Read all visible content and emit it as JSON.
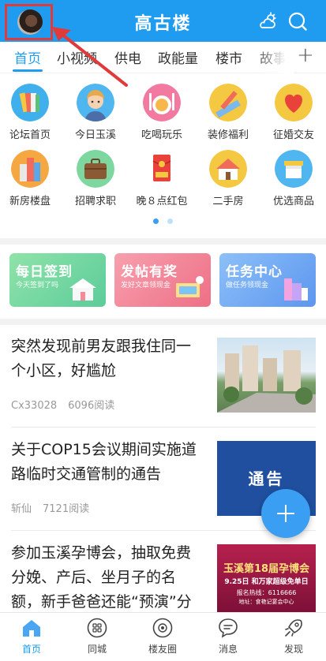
{
  "header": {
    "title": "高古楼",
    "avatar": "user-avatar",
    "icons": [
      "weather-cloud-icon",
      "search-icon"
    ],
    "accent": "#1f9cf0"
  },
  "tabs": {
    "items": [
      "首页",
      "小视频",
      "供电",
      "政能量",
      "楼市",
      "故事"
    ],
    "active": "首页",
    "more": "+"
  },
  "grid": [
    {
      "label": "论坛首页",
      "icon": "forum-books-icon"
    },
    {
      "label": "今日玉溪",
      "icon": "person-avatar-icon"
    },
    {
      "label": "吃喝玩乐",
      "icon": "dining-icon"
    },
    {
      "label": "装修福利",
      "icon": "ruler-pencil-icon"
    },
    {
      "label": "征婚交友",
      "icon": "heart-icon"
    },
    {
      "label": "新房楼盘",
      "icon": "buildings-icon"
    },
    {
      "label": "招聘求职",
      "icon": "briefcase-icon"
    },
    {
      "label": "晚８点红包",
      "icon": "red-envelope-icon"
    },
    {
      "label": "二手房",
      "icon": "house-icon"
    },
    {
      "label": "优选商品",
      "icon": "shopping-icon"
    }
  ],
  "cards": [
    {
      "title": "每日签到",
      "subtitle": "今天签到了吗",
      "color": "#7fd7a0"
    },
    {
      "title": "发帖有奖",
      "subtitle": "发好文章领现金",
      "color": "#f28a9a"
    },
    {
      "title": "任务中心",
      "subtitle": "做任务领现金",
      "color": "#6fa8f5"
    }
  ],
  "news": [
    {
      "title": "突然发现前男友跟我住同一个小区，好尴尬",
      "author": "Cx33028",
      "reads": "6096阅读"
    },
    {
      "title": "关于COP15会议期间实施道路临时交通管制的通告",
      "author": "斩仙",
      "reads": "7121阅读",
      "thumb_text": "通告"
    },
    {
      "title": "参加玉溪孕博会，抽取免费分娩、产后、坐月子的名额，新手爸爸还能“预演”分娩",
      "thumb_text": "玉溪第18届孕博会",
      "thumb_sub": "9.25日 和万家超级免单日",
      "thumb_tel": "报名热线：6116666",
      "thumb_addr": "地址：食艳记宴会中心"
    }
  ],
  "bottom_nav": [
    {
      "label": "首页",
      "icon": "home-icon"
    },
    {
      "label": "同城",
      "icon": "grid-apps-icon"
    },
    {
      "label": "楼友圈",
      "icon": "camera-circle-icon"
    },
    {
      "label": "消息",
      "icon": "chat-bubble-icon"
    },
    {
      "label": "发现",
      "icon": "rocket-icon"
    }
  ]
}
